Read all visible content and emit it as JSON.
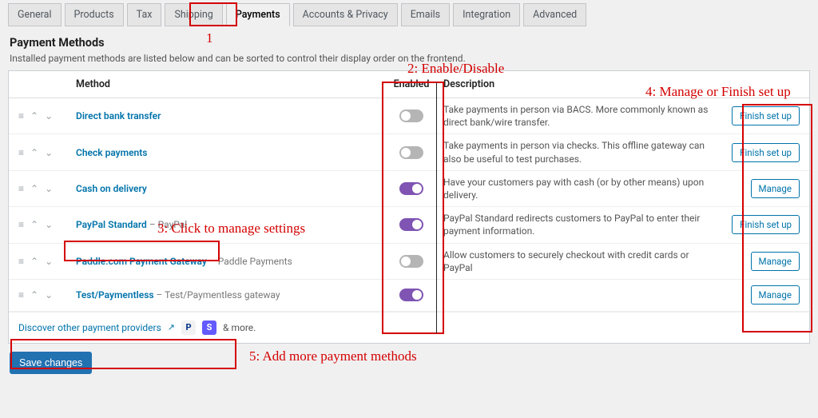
{
  "tabs": [
    "General",
    "Products",
    "Tax",
    "Shipping",
    "Payments",
    "Accounts & Privacy",
    "Emails",
    "Integration",
    "Advanced"
  ],
  "active_tab_index": 4,
  "section_title": "Payment Methods",
  "section_sub": "Installed payment methods are listed below and can be sorted to control their display order on the frontend.",
  "columns": {
    "method": "Method",
    "enabled": "Enabled",
    "description": "Description"
  },
  "rows": [
    {
      "name": "Direct bank transfer",
      "sub": "",
      "enabled": false,
      "desc": "Take payments in person via BACS. More commonly known as direct bank/wire transfer.",
      "action": "Finish set up"
    },
    {
      "name": "Check payments",
      "sub": "",
      "enabled": false,
      "desc": "Take payments in person via checks. This offline gateway can also be useful to test purchases.",
      "action": "Finish set up"
    },
    {
      "name": "Cash on delivery",
      "sub": "",
      "enabled": true,
      "desc": "Have your customers pay with cash (or by other means) upon delivery.",
      "action": "Manage"
    },
    {
      "name": "PayPal Standard",
      "sub": " – PayPal",
      "enabled": true,
      "desc": "PayPal Standard redirects customers to PayPal to enter their payment information.",
      "action": "Finish set up"
    },
    {
      "name": "Paddle.com Payment Gateway",
      "sub": " – Paddle Payments",
      "enabled": false,
      "desc": "Allow customers to securely checkout with credit cards or PayPal",
      "action": "Manage"
    },
    {
      "name": "Test/Paymentless",
      "sub": " – Test/Paymentless gateway",
      "enabled": true,
      "desc": "",
      "action": "Manage"
    }
  ],
  "discover": {
    "link": "Discover other payment providers",
    "tail": "& more."
  },
  "save_label": "Save changes",
  "annotations": {
    "n1": "1",
    "n2": "2: Enable/Disable",
    "n3": "3: Click to manage settings",
    "n4": "4: Manage or Finish set up",
    "n5": "5: Add more payment methods"
  }
}
